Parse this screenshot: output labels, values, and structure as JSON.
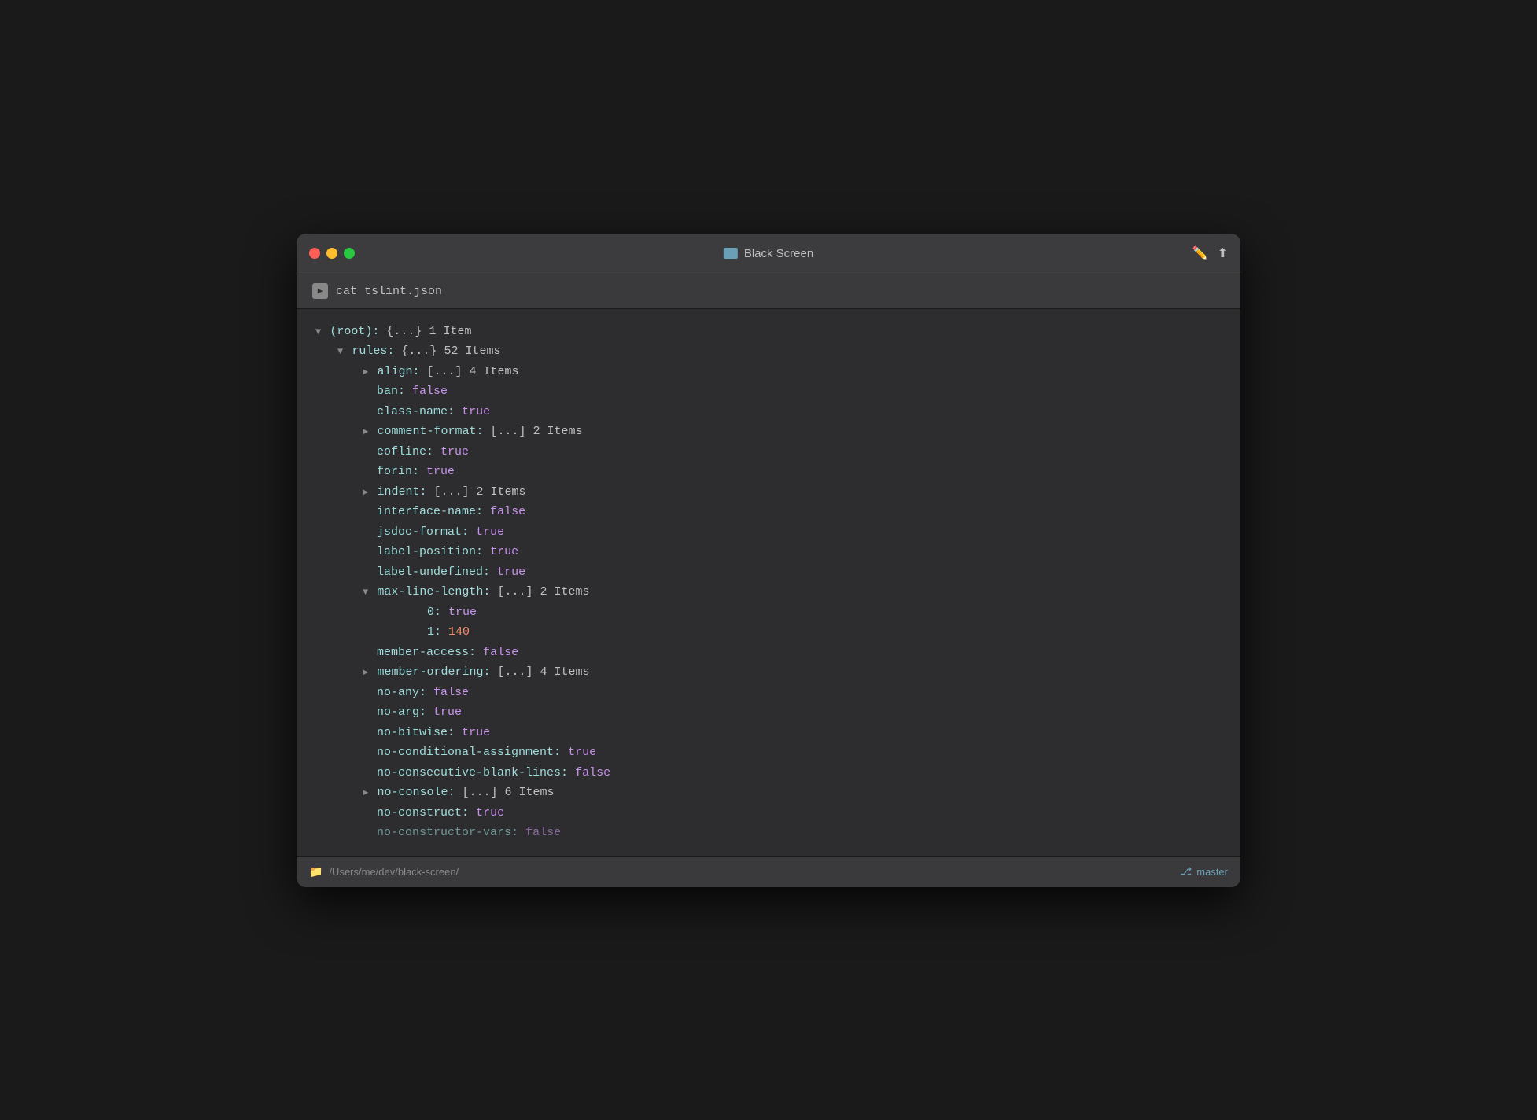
{
  "window": {
    "title": "Black Screen",
    "toolbar_command": "cat tslint.json"
  },
  "statusbar": {
    "path": "/Users/me/dev/black-screen/",
    "branch": "master"
  },
  "lines": [
    {
      "indent": 0,
      "type": "expandable",
      "key": "(root):",
      "bracket": "{...}",
      "count": "1 Item",
      "expanded": true
    },
    {
      "indent": 1,
      "type": "expandable",
      "key": "rules:",
      "bracket": "{...}",
      "count": "52 Items",
      "expanded": true
    },
    {
      "indent": 2,
      "type": "collapsed",
      "key": "align:",
      "bracket": "[...]",
      "count": "4 Items"
    },
    {
      "indent": 2,
      "type": "kv",
      "key": "ban:",
      "value": "false",
      "vtype": "bool-false"
    },
    {
      "indent": 2,
      "type": "kv",
      "key": "class-name:",
      "value": "true",
      "vtype": "bool-true"
    },
    {
      "indent": 2,
      "type": "collapsed",
      "key": "comment-format:",
      "bracket": "[...]",
      "count": "2 Items"
    },
    {
      "indent": 2,
      "type": "kv",
      "key": "eofline:",
      "value": "true",
      "vtype": "bool-true"
    },
    {
      "indent": 2,
      "type": "kv",
      "key": "forin:",
      "value": "true",
      "vtype": "bool-true"
    },
    {
      "indent": 2,
      "type": "collapsed",
      "key": "indent:",
      "bracket": "[...]",
      "count": "2 Items"
    },
    {
      "indent": 2,
      "type": "kv",
      "key": "interface-name:",
      "value": "false",
      "vtype": "bool-false"
    },
    {
      "indent": 2,
      "type": "kv",
      "key": "jsdoc-format:",
      "value": "true",
      "vtype": "bool-true"
    },
    {
      "indent": 2,
      "type": "kv",
      "key": "label-position:",
      "value": "true",
      "vtype": "bool-true"
    },
    {
      "indent": 2,
      "type": "kv",
      "key": "label-undefined:",
      "value": "true",
      "vtype": "bool-true"
    },
    {
      "indent": 2,
      "type": "expandable",
      "key": "max-line-length:",
      "bracket": "[...]",
      "count": "2 Items",
      "expanded": true
    },
    {
      "indent": 3,
      "type": "kv",
      "key": "0:",
      "value": "true",
      "vtype": "bool-true"
    },
    {
      "indent": 3,
      "type": "kv",
      "key": "1:",
      "value": "140",
      "vtype": "num"
    },
    {
      "indent": 2,
      "type": "kv",
      "key": "member-access:",
      "value": "false",
      "vtype": "bool-false"
    },
    {
      "indent": 2,
      "type": "collapsed",
      "key": "member-ordering:",
      "bracket": "[...]",
      "count": "4 Items"
    },
    {
      "indent": 2,
      "type": "kv",
      "key": "no-any:",
      "value": "false",
      "vtype": "bool-false"
    },
    {
      "indent": 2,
      "type": "kv",
      "key": "no-arg:",
      "value": "true",
      "vtype": "bool-true"
    },
    {
      "indent": 2,
      "type": "kv",
      "key": "no-bitwise:",
      "value": "true",
      "vtype": "bool-true"
    },
    {
      "indent": 2,
      "type": "kv",
      "key": "no-conditional-assignment:",
      "value": "true",
      "vtype": "bool-true"
    },
    {
      "indent": 2,
      "type": "kv",
      "key": "no-consecutive-blank-lines:",
      "value": "false",
      "vtype": "bool-false"
    },
    {
      "indent": 2,
      "type": "collapsed",
      "key": "no-console:",
      "bracket": "[...]",
      "count": "6 Items"
    },
    {
      "indent": 2,
      "type": "kv",
      "key": "no-construct:",
      "value": "true",
      "vtype": "bool-true"
    },
    {
      "indent": 2,
      "type": "kv-truncated",
      "key": "no-constructor-vars:",
      "value": "false",
      "vtype": "bool-false"
    }
  ]
}
